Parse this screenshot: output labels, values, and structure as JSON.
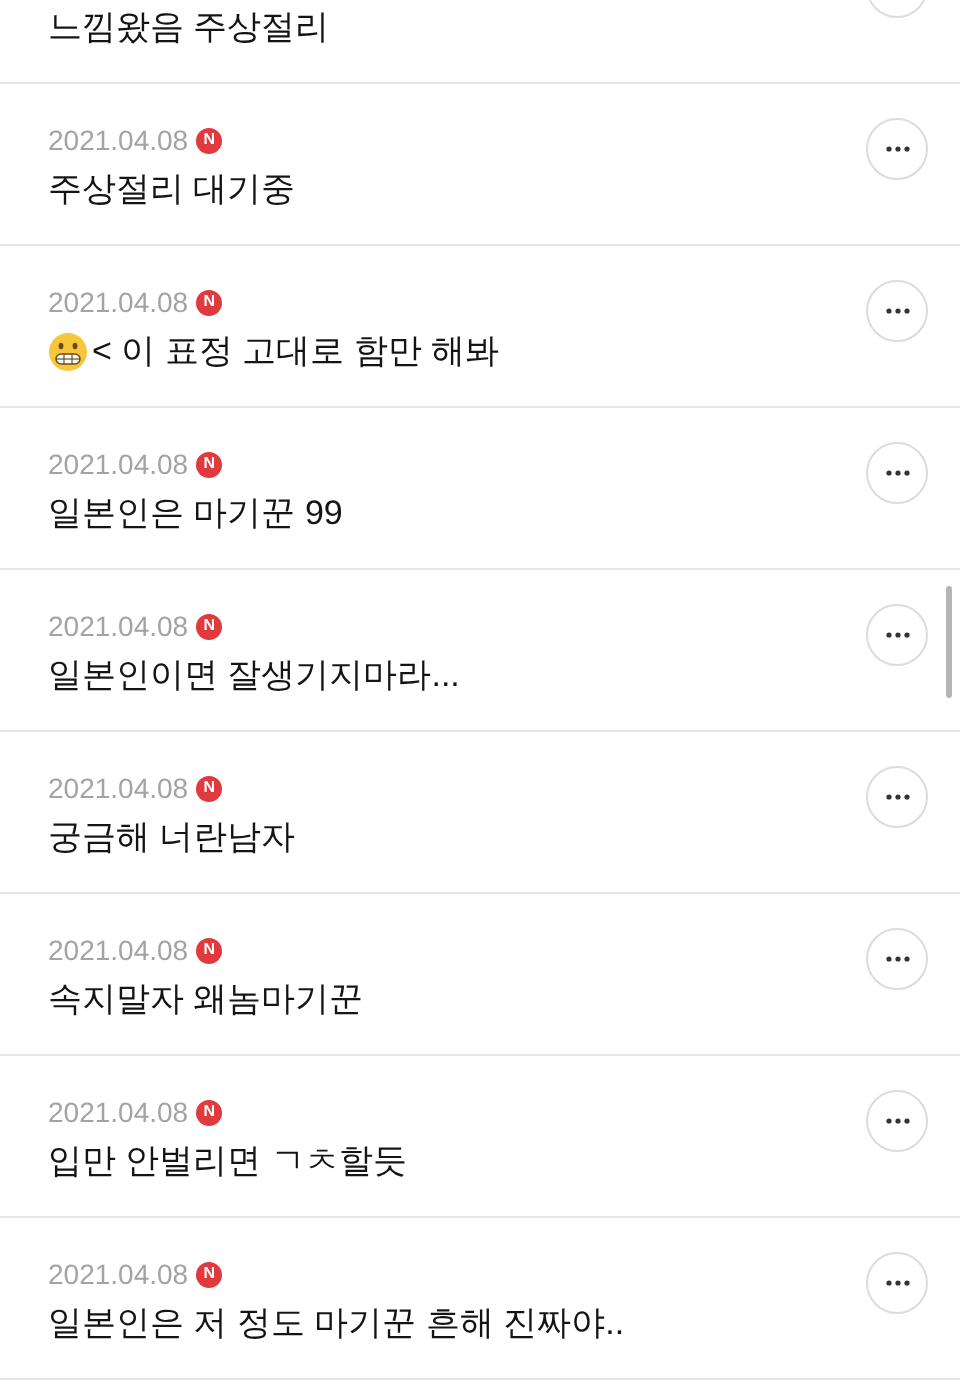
{
  "comments": [
    {
      "text": "느낌왔음 주상절리"
    },
    {
      "date": "2021.04.08",
      "badge": "N",
      "text": "주상절리 대기중"
    },
    {
      "date": "2021.04.08",
      "badge": "N",
      "text": "< 이 표정 고대로 함만 해봐",
      "leading_emoji": true
    },
    {
      "date": "2021.04.08",
      "badge": "N",
      "text": "일본인은 마기꾼 99"
    },
    {
      "date": "2021.04.08",
      "badge": "N",
      "text": "일본인이면 잘생기지마라..."
    },
    {
      "date": "2021.04.08",
      "badge": "N",
      "text": "궁금해 너란남자"
    },
    {
      "date": "2021.04.08",
      "badge": "N",
      "text": "속지말자 왜놈마기꾼"
    },
    {
      "date": "2021.04.08",
      "badge": "N",
      "text": "입만 안벌리면 ㄱㅊ할듯"
    },
    {
      "date": "2021.04.08",
      "badge": "N",
      "text": "일본인은 저 정도 마기꾼 흔해 진짜야.."
    }
  ]
}
